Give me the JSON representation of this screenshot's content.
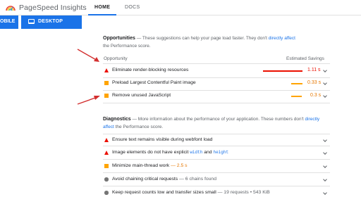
{
  "header": {
    "app_title": "PageSpeed Insights",
    "nav_home": "HOME",
    "nav_docs": "DOCS"
  },
  "device_tabs": {
    "mobile": "OBILE",
    "desktop": "DESKTOP"
  },
  "opportunities": {
    "title": "Opportunities",
    "desc_dash": " — These suggestions can help your page load faster. They don't ",
    "desc_link": "directly affect",
    "desc_line2": "Performance score.",
    "desc_line2_prefix": "the ",
    "col_left": "Opportunity",
    "col_right": "Estimated Savings",
    "items": [
      {
        "label": "Eliminate render-blocking resources",
        "value": "1.11 s",
        "severity": "fail",
        "fraction": 1.0
      },
      {
        "label": "Preload Largest Contentful Paint image",
        "value": "0.33 s",
        "severity": "average",
        "fraction": 0.3
      },
      {
        "label": "Remove unused JavaScript",
        "value": "0.3 s",
        "severity": "average",
        "fraction": 0.27
      }
    ]
  },
  "diagnostics": {
    "title": "Diagnostics",
    "desc": " — More information about the performance of your application. These numbers don't ",
    "desc_link1": "directly",
    "desc_link2": "affect",
    "desc_tail": " the Performance score.",
    "items": [
      {
        "label": "Ensure text remains visible during webfont load",
        "severity": "fail"
      },
      {
        "label_a": "Image elements do not have explicit ",
        "code1": "width",
        "and": " and ",
        "code2": "height",
        "severity": "fail"
      },
      {
        "label": "Minimize main-thread work",
        "extra": " — 2.5 s",
        "severity": "average"
      },
      {
        "label": "Avoid chaining critical requests",
        "extra": " — 6 chains found",
        "severity": "info"
      },
      {
        "label": "Keep request counts low and transfer sizes small",
        "extra": " — 19 requests • 543 KiB",
        "severity": "info"
      }
    ]
  },
  "colors": {
    "accent": "#1a73e8",
    "fail": "#eb0f00",
    "average": "#ffa400",
    "annotation_arrow": "#d32f2f"
  }
}
